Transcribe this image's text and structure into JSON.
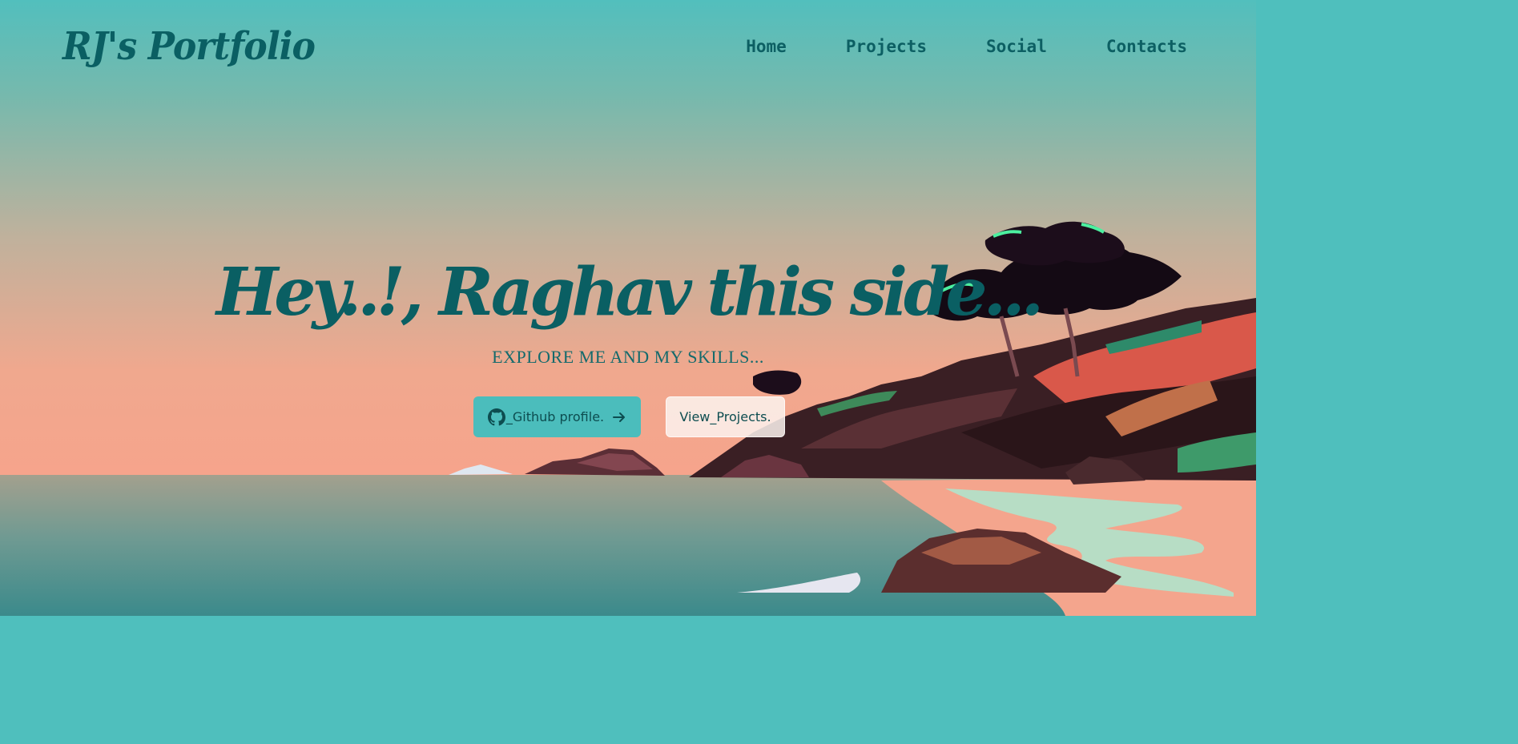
{
  "brand": {
    "name": "RJ's Portfolio"
  },
  "nav": {
    "items": [
      {
        "label": "Home"
      },
      {
        "label": "Projects"
      },
      {
        "label": "Social"
      },
      {
        "label": "Contacts"
      }
    ]
  },
  "hero": {
    "title": "Hey..!, Raghav this side...",
    "subtitle": "EXPLORE ME AND MY SKILLS..."
  },
  "buttons": {
    "github": {
      "label": "_Github profile.",
      "icon": "github-icon",
      "trailing_icon": "arrow-right-icon"
    },
    "projects": {
      "label": "View_Projects."
    }
  },
  "colors": {
    "brand_text": "#0a5f63",
    "sky_top": "#52bfbd",
    "sky_bottom": "#f5a58e",
    "sea_bottom": "#3a8a8a",
    "github_button": "#4bbdbc",
    "projects_button": "#fcf2ed"
  }
}
